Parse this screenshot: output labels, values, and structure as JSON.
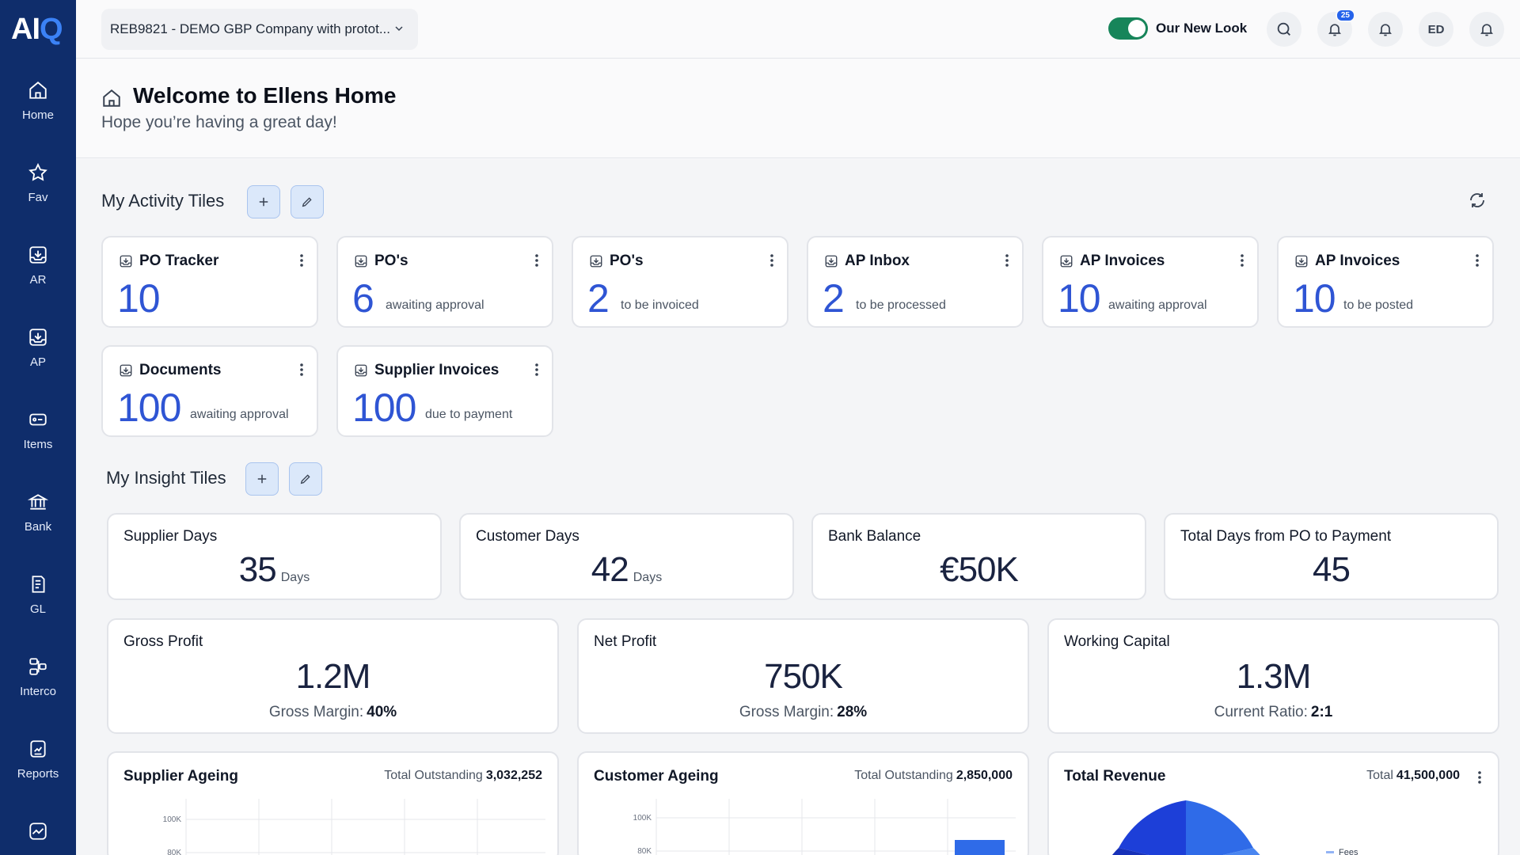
{
  "app": {
    "logo_a": "AI",
    "logo_q": "Q"
  },
  "sidebar": {
    "items": [
      {
        "label": "Home",
        "icon": "home-icon"
      },
      {
        "label": "Fav",
        "icon": "star-icon"
      },
      {
        "label": "AR",
        "icon": "inbox-download-icon"
      },
      {
        "label": "AP",
        "icon": "inbox-download-icon"
      },
      {
        "label": "Items",
        "icon": "tag-icon"
      },
      {
        "label": "Bank",
        "icon": "bank-icon"
      },
      {
        "label": "GL",
        "icon": "ledger-icon"
      },
      {
        "label": "Interco",
        "icon": "network-icon"
      },
      {
        "label": "Reports",
        "icon": "report-icon"
      },
      {
        "label": "",
        "icon": "chart-icon"
      }
    ]
  },
  "topbar": {
    "company": "REB9821 - DEMO GBP Company with protot...",
    "toggle_label": "Our New Look",
    "notification_count": "25",
    "avatar_initials": "ED"
  },
  "welcome": {
    "title": "Welcome to Ellens Home",
    "subtitle": "Hope you’re having a great day!"
  },
  "activity": {
    "title": "My Activity Tiles",
    "tiles": [
      {
        "title": "PO Tracker",
        "value": "10",
        "sub": ""
      },
      {
        "title": "PO's",
        "value": "6",
        "sub": "awaiting approval"
      },
      {
        "title": "PO's",
        "value": "2",
        "sub": "to be invoiced"
      },
      {
        "title": "AP Inbox",
        "value": "2",
        "sub": "to be processed"
      },
      {
        "title": "AP Invoices",
        "value": "10",
        "sub": "awaiting approval"
      },
      {
        "title": "AP Invoices",
        "value": "10",
        "sub": "to be posted"
      },
      {
        "title": "Documents",
        "value": "100",
        "sub": "awaiting approval"
      },
      {
        "title": "Supplier Invoices",
        "value": "100",
        "sub": "due to payment"
      }
    ]
  },
  "insight": {
    "title": "My Insight Tiles",
    "kpis": [
      {
        "title": "Supplier Days",
        "value": "35",
        "unit": "Days"
      },
      {
        "title": "Customer Days",
        "value": "42",
        "unit": "Days"
      },
      {
        "title": "Bank Balance",
        "value": "€50K",
        "unit": ""
      },
      {
        "title": "Total Days from PO to Payment",
        "value": "45",
        "unit": ""
      }
    ],
    "profits": [
      {
        "title": "Gross Profit",
        "value": "1.2M",
        "sub_label": "Gross Margin:",
        "sub_value": "40%"
      },
      {
        "title": "Net Profit",
        "value": "750K",
        "sub_label": "Gross Margin:",
        "sub_value": "28%"
      },
      {
        "title": "Working Capital",
        "value": "1.3M",
        "sub_label": "Current Ratio:",
        "sub_value": "2:1"
      }
    ],
    "charts": [
      {
        "title": "Supplier Ageing",
        "total_label": "Total Outstanding",
        "total_value": "3,032,252",
        "ticks": [
          "100K",
          "80K"
        ]
      },
      {
        "title": "Customer Ageing",
        "total_label": "Total Outstanding",
        "total_value": "2,850,000",
        "ticks": [
          "100K",
          "80K"
        ]
      },
      {
        "title": "Total Revenue",
        "total_label": "Total",
        "total_value": "41,500,000",
        "legend": [
          "Fees"
        ]
      }
    ]
  },
  "colors": {
    "sidebar": "#0f2d6b",
    "accent": "#2f55d4",
    "toggle_on": "#17855a"
  }
}
